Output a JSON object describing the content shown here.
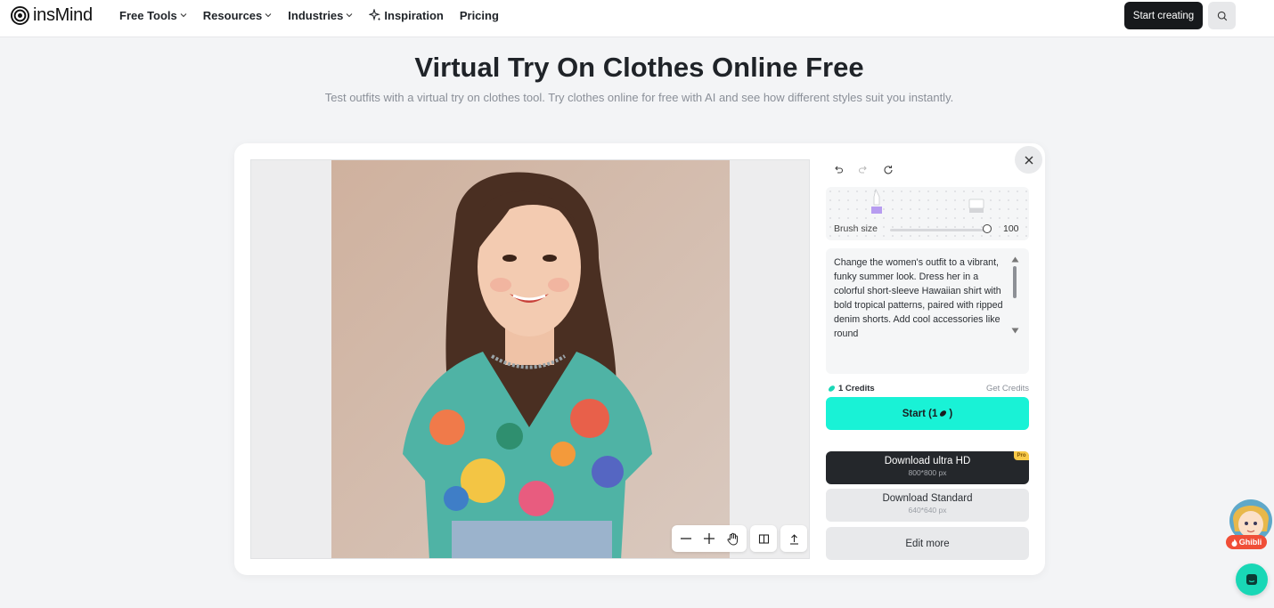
{
  "header": {
    "logo_text": "insMind",
    "nav": [
      {
        "label": "Free Tools",
        "has_dropdown": true
      },
      {
        "label": "Resources",
        "has_dropdown": true
      },
      {
        "label": "Industries",
        "has_dropdown": true
      },
      {
        "label": "Inspiration",
        "has_dropdown": false,
        "icon": "sparkle-icon"
      },
      {
        "label": "Pricing",
        "has_dropdown": false
      }
    ],
    "start_creating_label": "Start creating",
    "search_icon": "search-icon"
  },
  "hero": {
    "title": "Virtual Try On Clothes Online Free",
    "subtitle": "Test outfits with a virtual try on clothes tool. Try clothes online for free with AI and see how different styles suit you instantly."
  },
  "editor": {
    "tools": [
      "undo-icon",
      "redo-icon",
      "reset-icon"
    ],
    "brush": {
      "label": "Brush size",
      "value": "100"
    },
    "prompt_text": "Change the women's outfit to a vibrant, funky summer look. Dress her in a colorful short-sleeve Hawaiian shirt with bold tropical patterns, paired with ripped denim shorts. Add cool accessories like round",
    "credits": {
      "label": "1 Credits",
      "get_label": "Get Credits"
    },
    "start_label": "Start (1",
    "start_suffix": ")",
    "download_hd": {
      "title": "Download ultra HD",
      "size": "800*800 px",
      "badge": "Pro"
    },
    "download_standard": {
      "title": "Download Standard",
      "size": "640*640 px"
    },
    "edit_more_label": "Edit more"
  },
  "floating": {
    "ghibli_label": "Ghibli"
  },
  "colors": {
    "accent": "#19f2d6",
    "dark_button": "#24272b",
    "chat": "#19d7b6",
    "ghibli_badge": "#f04e37"
  }
}
